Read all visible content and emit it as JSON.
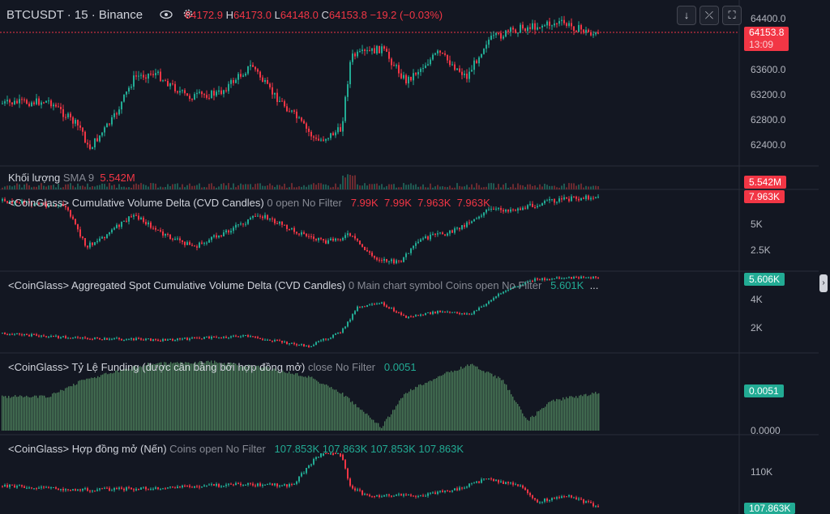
{
  "symbol": "BTCUSDT · 15 · Binance",
  "ohlc": {
    "o_label": "O",
    "o": "64172.9",
    "h_label": "H",
    "h": "64173.0",
    "l_label": "L",
    "l": "64148.0",
    "c_label": "C",
    "c": "64153.8",
    "chg": "−19.2 (−0.03%)"
  },
  "price_axis": [
    "64400.0",
    "63600.0",
    "63200.0",
    "62800.0",
    "62400.0"
  ],
  "price_tag": {
    "price": "64153.8",
    "countdown": "13:09"
  },
  "volume": {
    "title": "Khối lượng",
    "sub": "SMA 9",
    "value": "5.542M",
    "tag": "5.542M"
  },
  "cvd": {
    "title": "<CoinGlass> Cumulative Volume Delta (CVD Candles)",
    "sub": "0 open No Filter",
    "vals": [
      "7.99K",
      "7.99K",
      "7.963K",
      "7.963K"
    ],
    "axis": [
      "5K",
      "2.5K"
    ],
    "tag": "7.963K"
  },
  "spot_cvd": {
    "title": "<CoinGlass> Aggregated Spot Cumulative Volume Delta (CVD Candles)",
    "sub": "0 Main chart symbol Coins open No Filter",
    "val": "5.601K",
    "more": "...",
    "axis": [
      "4K",
      "2K"
    ],
    "tag": "5.606K"
  },
  "funding": {
    "title": "<CoinGlass> Tỷ Lệ Funding (được cân bằng bởi hợp đồng mở)",
    "sub": "close No Filter",
    "val": "0.0051",
    "axis": [
      "0.0000"
    ],
    "tag": "0.0051"
  },
  "oi": {
    "title": "<CoinGlass> Hợp đồng mở (Nến)",
    "sub": "Coins open No Filter",
    "vals": [
      "107.853K",
      "107.863K",
      "107.853K",
      "107.863K"
    ],
    "axis": [
      "110K"
    ],
    "tag": "107.863K"
  },
  "buttons": {
    "down": "↓",
    "collapse": "⤫",
    "maximize": "⛶",
    "edge": "›"
  },
  "colors": {
    "bg": "#131722",
    "up": "#22ab94",
    "down": "#f23645",
    "funding": "#4a7a58"
  }
}
